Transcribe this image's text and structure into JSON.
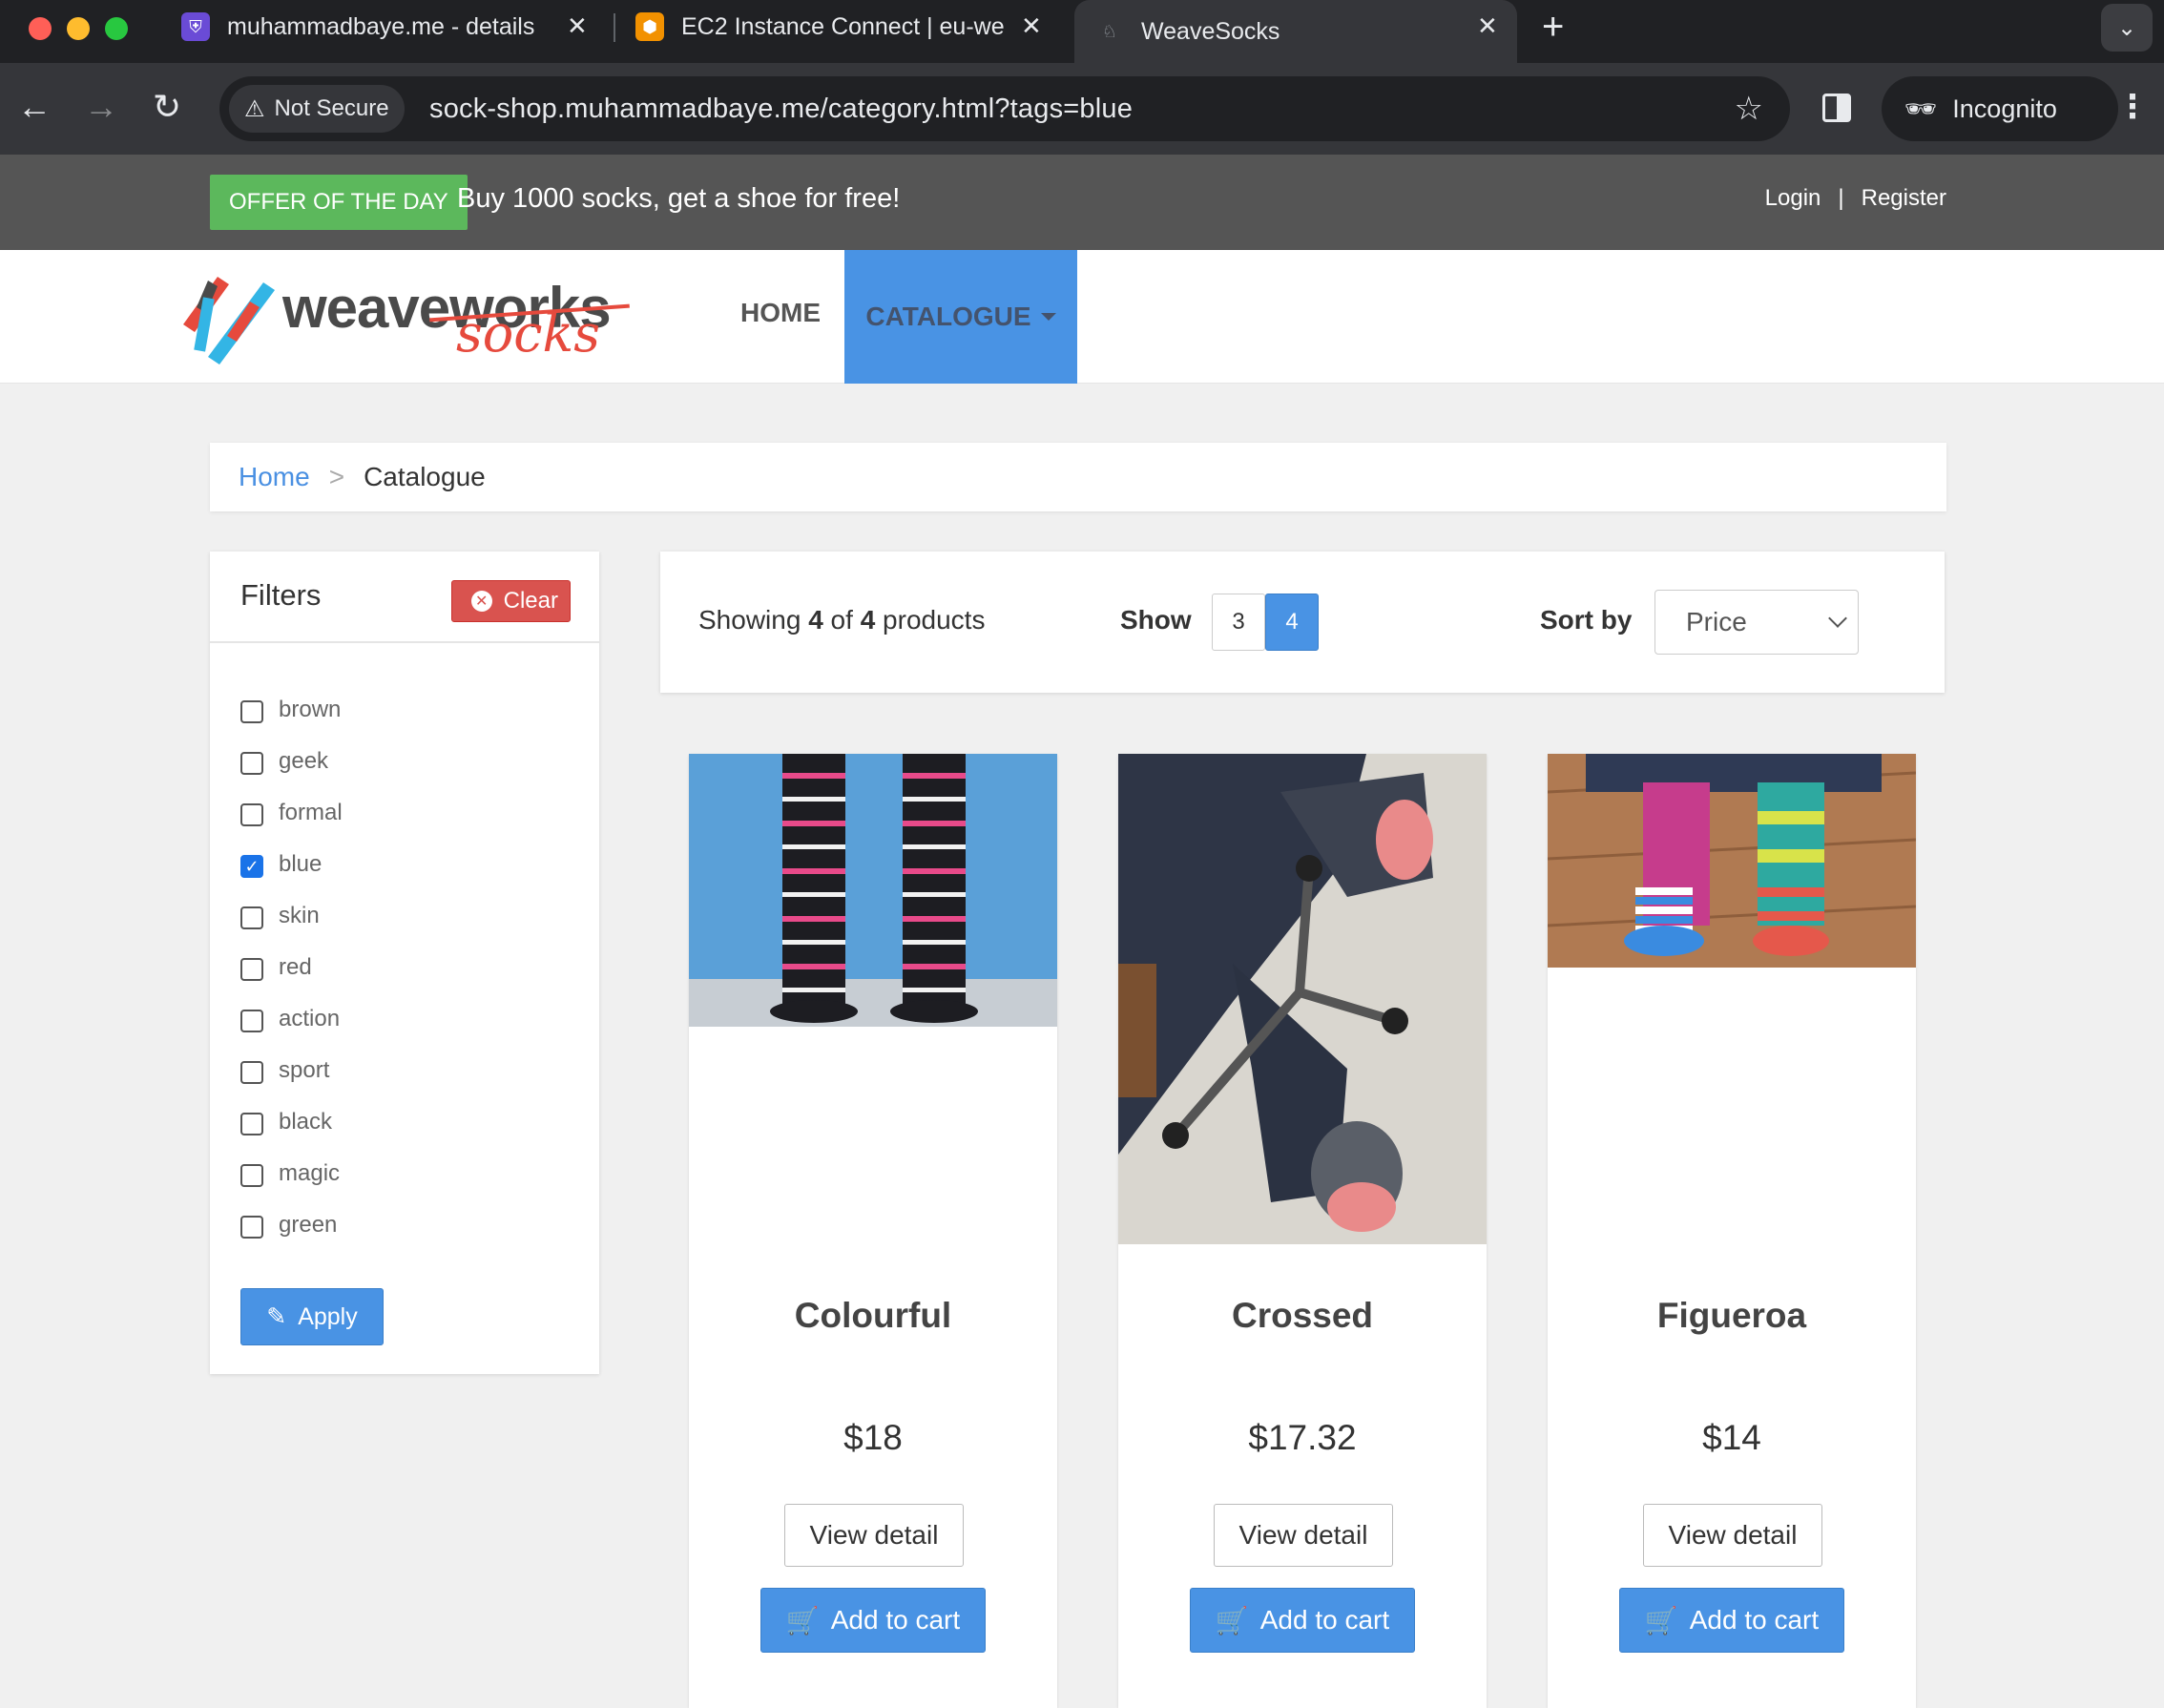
{
  "browser": {
    "tabs": [
      {
        "title": "muhammadbaye.me - details",
        "active": false,
        "favicon": "shield-favicon",
        "favicon_color": "#6a4bd6"
      },
      {
        "title": "EC2 Instance Connect | eu-we",
        "active": false,
        "favicon": "aws-cube-favicon",
        "favicon_color": "#f29100"
      },
      {
        "title": "WeaveSocks",
        "active": true,
        "favicon": "sock-favicon",
        "favicon_color": "#9aa0a6"
      }
    ],
    "security_label": "Not Secure",
    "url": "sock-shop.muhammadbaye.me/category.html?tags=blue",
    "profile_label": "Incognito"
  },
  "topbar": {
    "offer_badge": "OFFER OF THE DAY",
    "offer_text": "Buy 1000 socks, get a shoe for free!",
    "login": "Login",
    "separator": "|",
    "register": "Register"
  },
  "header": {
    "logo_word1": "weave",
    "logo_word2": "works",
    "logo_word3": "socks",
    "nav_home": "HOME",
    "nav_catalogue": "CATALOGUE"
  },
  "breadcrumb": {
    "home": "Home",
    "separator": ">",
    "current": "Catalogue"
  },
  "filters": {
    "title": "Filters",
    "clear_label": "Clear",
    "apply_label": "Apply",
    "tags": [
      {
        "label": "brown",
        "checked": false
      },
      {
        "label": "geek",
        "checked": false
      },
      {
        "label": "formal",
        "checked": false
      },
      {
        "label": "blue",
        "checked": true
      },
      {
        "label": "skin",
        "checked": false
      },
      {
        "label": "red",
        "checked": false
      },
      {
        "label": "action",
        "checked": false
      },
      {
        "label": "sport",
        "checked": false
      },
      {
        "label": "black",
        "checked": false
      },
      {
        "label": "magic",
        "checked": false
      },
      {
        "label": "green",
        "checked": false
      }
    ]
  },
  "products_bar": {
    "showing_prefix": "Showing",
    "shown": "4",
    "of": "of",
    "total": "4",
    "products_word": "products",
    "show_label": "Show",
    "show_options": [
      "3",
      "4"
    ],
    "show_selected": "4",
    "sort_label": "Sort by",
    "sort_value": "Price"
  },
  "products": [
    {
      "name": "Colourful",
      "price": "$18",
      "view_label": "View detail",
      "cart_label": "Add to cart"
    },
    {
      "name": "Crossed",
      "price": "$17.32",
      "view_label": "View detail",
      "cart_label": "Add to cart"
    },
    {
      "name": "Figueroa",
      "price": "$14",
      "view_label": "View detail",
      "cart_label": "Add to cart"
    }
  ],
  "colors": {
    "accent_blue": "#4993e4",
    "offer_green": "#5cb85c",
    "clear_red": "#d9534f",
    "topbar_gray": "#555555"
  }
}
